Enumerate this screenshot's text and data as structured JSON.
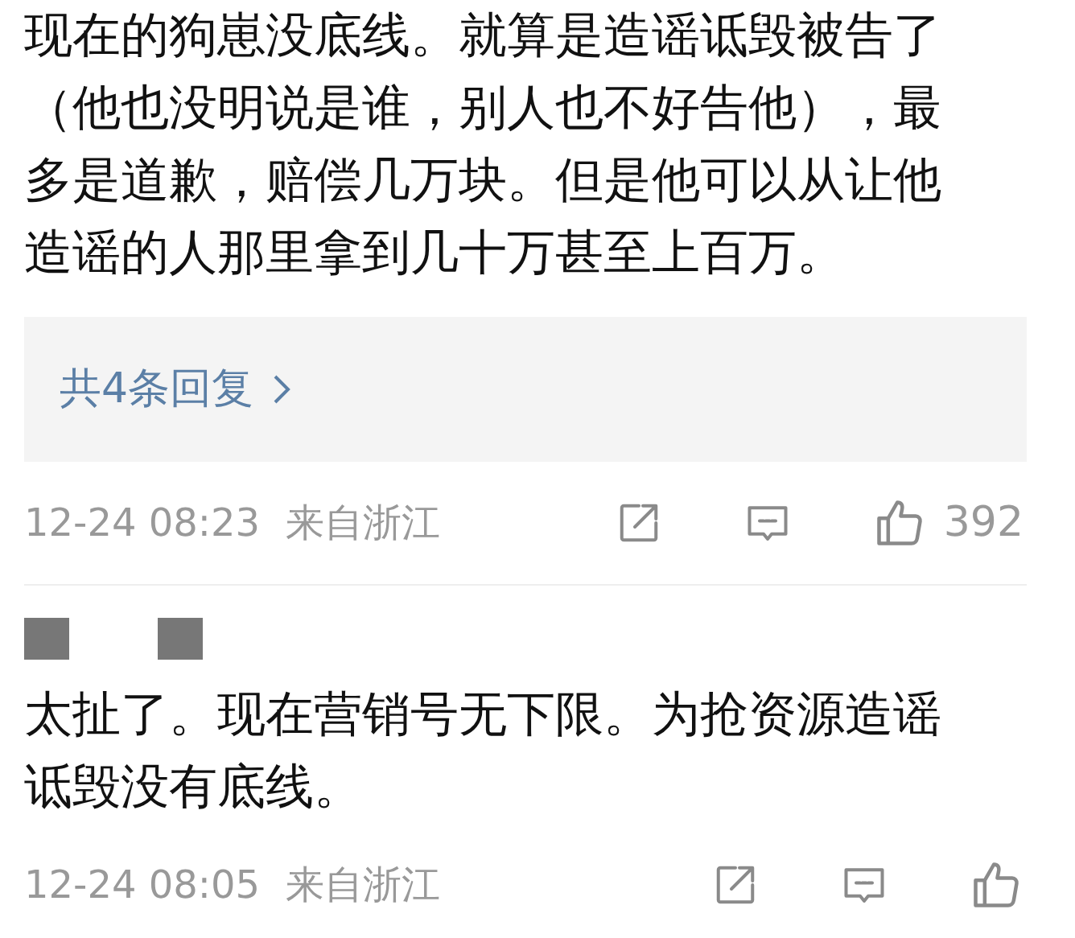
{
  "comments": [
    {
      "lines": [
        "现在的狗崽没底线。就算是造谣诋毁被告了",
        "（他也没明说是谁，别人也不好告他），最",
        "多是道歉，赔偿几万块。但是他可以从让他",
        "造谣的人那里拿到几十万甚至上百万。"
      ],
      "replies_link": "共4条回复",
      "time": "12-24 08:23",
      "location": "来自浙江",
      "likes": "392"
    },
    {
      "author": {
        "kind": "redacted"
      },
      "lines": [
        "太扯了。现在营销号无下限。为抢资源造谣",
        "诋毁没有底线。"
      ],
      "time": "12-24 08:05",
      "location": "来自浙江"
    }
  ]
}
